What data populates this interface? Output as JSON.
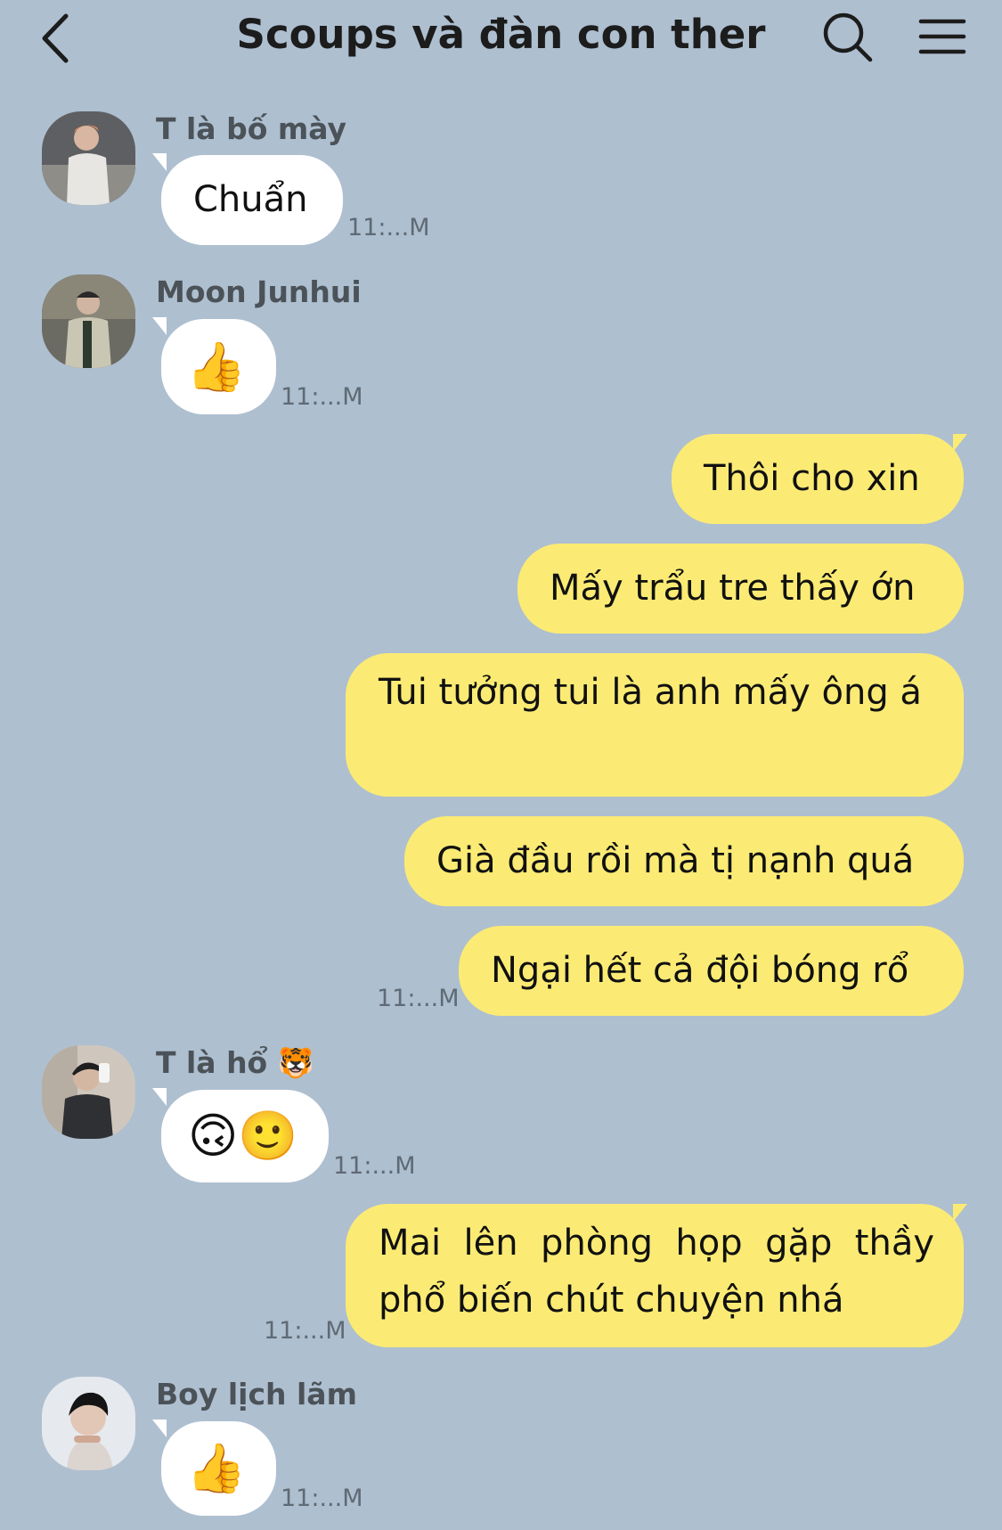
{
  "header": {
    "title": "Scoups và đàn con ther",
    "back_icon": "chevron-left-icon",
    "search_icon": "search-icon",
    "menu_icon": "hamburger-menu-icon"
  },
  "messages": [
    {
      "sender": "T là bố mày",
      "text": "Chuẩn",
      "time": "11:...M"
    },
    {
      "sender": "Moon Junhui",
      "text": "👍",
      "time": "11:...M"
    },
    {
      "text": "Thôi cho xin"
    },
    {
      "text": "Mấy trẩu tre thấy ớn"
    },
    {
      "text": "Tui tưởng tui là anh mấy ông á"
    },
    {
      "text": "Già đầu rồi mà tị nạnh quá"
    },
    {
      "text": "Ngại hết cả đội bóng rổ",
      "time": "11:...M"
    },
    {
      "sender": "T là hổ 🐯",
      "text": "🙃🙂",
      "time": "11:...M"
    },
    {
      "text": "Mai lên phòng họp gặp thầy phổ biến chút chuyện nhá",
      "time": "11:...M"
    },
    {
      "sender": "Boy lịch lãm",
      "text": "👍",
      "time": "11:...M"
    }
  ],
  "colors": {
    "background": "#aebfd0",
    "outgoing_bubble": "#fbeb74",
    "incoming_bubble": "#ffffff"
  }
}
